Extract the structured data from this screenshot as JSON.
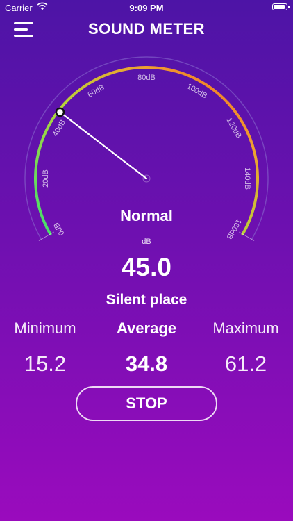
{
  "status_bar": {
    "carrier": "Carrier",
    "time": "9:09 PM",
    "wifi_icon": "wifi-icon",
    "battery_icon": "battery-icon",
    "battery_level": 0.95
  },
  "nav": {
    "title": "SOUND METER",
    "menu_icon": "hamburger-menu-icon"
  },
  "gauge": {
    "min_db": 0,
    "max_db": 160,
    "current_db": 45.0,
    "active_arc_db": 45.0,
    "ticks": [
      "0dB",
      "20dB",
      "40dB",
      "60dB",
      "80dB",
      "100dB",
      "120dB",
      "140dB",
      "160dB"
    ],
    "colors": {
      "track": "#8a6fcf",
      "low": "#3fe06e",
      "mid": "#b7d33a",
      "high": "#f0a030",
      "max": "#f25a1e",
      "needle": "#ffffff"
    }
  },
  "reading": {
    "status": "Normal",
    "unit": "dB",
    "value": "45.0",
    "environment": "Silent place"
  },
  "stats": {
    "minimum_label": "Minimum",
    "minimum_value": "15.2",
    "average_label": "Average",
    "average_value": "34.8",
    "maximum_label": "Maximum",
    "maximum_value": "61.2"
  },
  "actions": {
    "stop_label": "STOP"
  }
}
